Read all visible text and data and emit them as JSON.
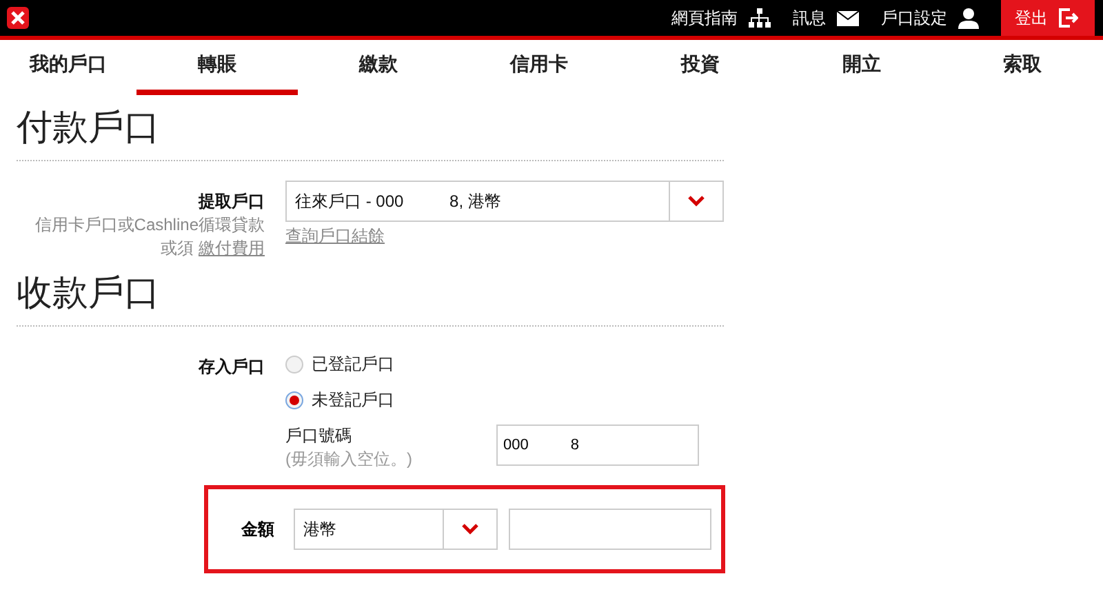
{
  "header": {
    "links": [
      {
        "label": "網頁指南",
        "kind": "sitemap"
      },
      {
        "label": "訊息",
        "kind": "mail"
      },
      {
        "label": "戶口設定",
        "kind": "user"
      }
    ],
    "logout": "登出"
  },
  "tabs": [
    {
      "label": "我的戶口",
      "selected": false
    },
    {
      "label": "轉賬",
      "selected": true
    },
    {
      "label": "繳款",
      "selected": false
    },
    {
      "label": "信用卡",
      "selected": false
    },
    {
      "label": "投資",
      "selected": false
    },
    {
      "label": "開立",
      "selected": false
    },
    {
      "label": "索取",
      "selected": false
    }
  ],
  "payer": {
    "heading": "付款戶口",
    "label": "提取戶口",
    "note": "信用卡戶口或Cashline循環貸款",
    "note2": "或須",
    "note_link": "繳付費用",
    "account": "往來戶口 - 000          8, 港幣",
    "balance_link": "查詢戶口結餘"
  },
  "payee": {
    "heading": "收款戶口",
    "label": "存入戶口",
    "options": [
      {
        "label": "已登記戶口",
        "selected": false
      },
      {
        "label": "未登記戶口",
        "selected": true
      }
    ],
    "number_label": "戶口號碼",
    "number_hint": "(毋須輸入空位。)",
    "number_value": "000          8"
  },
  "amount": {
    "label": "金額",
    "currency": "港幣",
    "highlighted": true
  }
}
